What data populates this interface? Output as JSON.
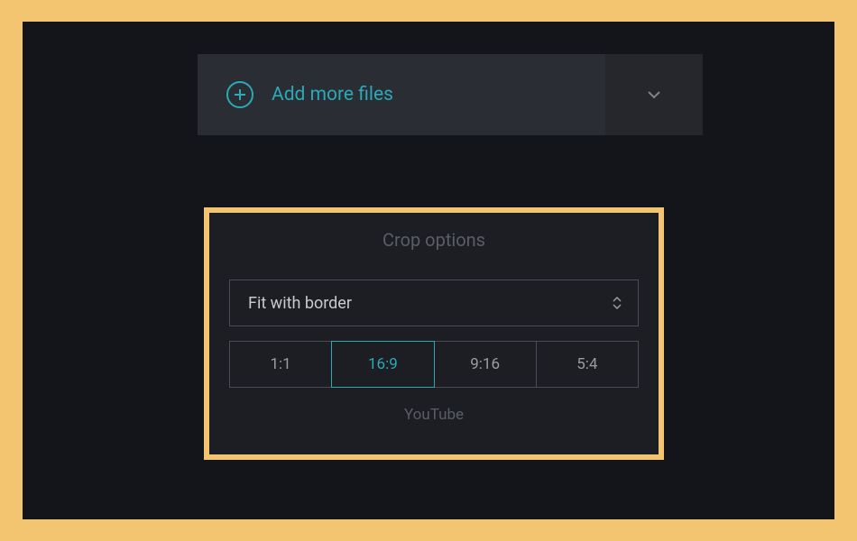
{
  "add_files": {
    "label": "Add more files"
  },
  "crop": {
    "title": "Crop options",
    "mode_selected": "Fit with border",
    "ratios": [
      {
        "label": "1:1",
        "selected": false
      },
      {
        "label": "16:9",
        "selected": true
      },
      {
        "label": "9:16",
        "selected": false
      },
      {
        "label": "5:4",
        "selected": false
      }
    ],
    "sublabel": "YouTube"
  },
  "colors": {
    "accent": "#2aa9b8",
    "highlight_border": "#f4c570",
    "app_bg": "#13151a",
    "panel_bg": "#1c1e24",
    "button_bg": "#2a2d33"
  }
}
